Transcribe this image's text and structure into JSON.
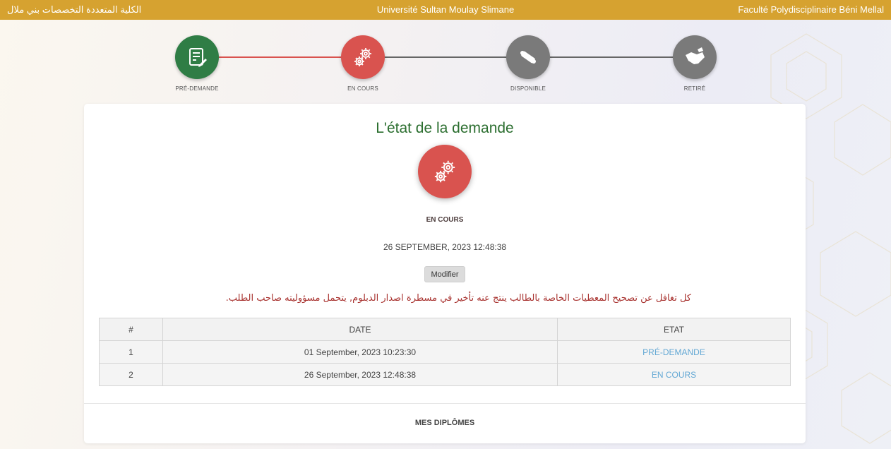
{
  "topbar": {
    "left_text": "الكلية المتعددة التخصصات بني ملال",
    "center_text": "Université Sultan Moulay Slimane",
    "right_text": "Faculté Polydisciplinaire Béni Mellal",
    "color": "#d6a230"
  },
  "steps": [
    {
      "label": "PRÉ-DEMANDE",
      "icon": "document-edit-icon",
      "color": "#2f7d45"
    },
    {
      "label": "EN COURS",
      "icon": "gears-icon",
      "color": "#d9534f"
    },
    {
      "label": "DISPONIBLE",
      "icon": "diploma-scroll-icon",
      "color": "#7a7a7a"
    },
    {
      "label": "RETIRÉ",
      "icon": "handshake-icon",
      "color": "#7a7a7a"
    }
  ],
  "card": {
    "title": "L'état de la demande",
    "status_icon": "gears-icon",
    "status": "EN COURS",
    "status_date": "26 SEPTEMBER, 2023 12:48:38",
    "modify_label": "Modifier",
    "warning": "كل تغافل عن تصحيح المعطيات الخاصة بالطالب ينتج عنه تأخير في مسطرة اصدار الدبلوم, يتحمل مسؤوليته صاحب الطلب."
  },
  "table": {
    "headers": [
      "#",
      "DATE",
      "ETAT"
    ],
    "rows": [
      {
        "num": "1",
        "date": "01 September, 2023 10:23:30",
        "etat": "PRÉ-DEMANDE"
      },
      {
        "num": "2",
        "date": "26 September, 2023 12:48:38",
        "etat": "EN COURS"
      }
    ]
  },
  "footer": {
    "link_label": "MES DIPLÔMES"
  }
}
